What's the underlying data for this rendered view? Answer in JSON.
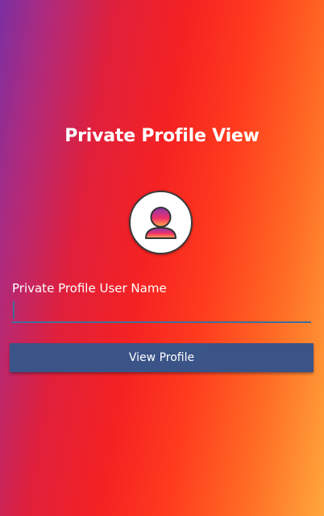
{
  "screen": {
    "title": "Private Profile View",
    "avatar_icon": "user-profile-icon",
    "username_field": {
      "label": "Private Profile User Name",
      "value": "",
      "placeholder": ""
    },
    "view_button_label": "View Profile"
  },
  "colors": {
    "gradient_start": "#7b2fa3",
    "gradient_mid": "#f52222",
    "gradient_end": "#ffa73c",
    "button": "#3b5488",
    "input_underline": "#3f6f9a"
  }
}
